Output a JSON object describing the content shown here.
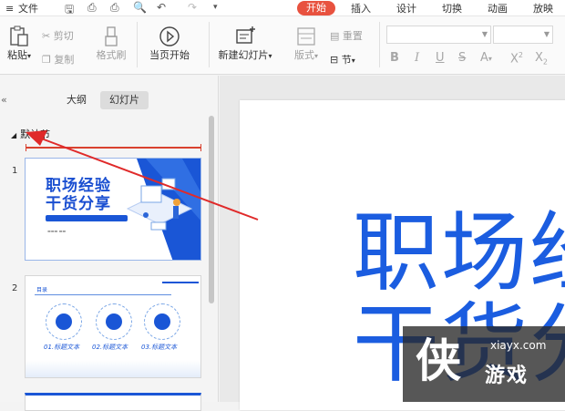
{
  "menubar": {
    "file_label": "文件",
    "tabs": [
      {
        "label": "开始",
        "active": true
      },
      {
        "label": "插入"
      },
      {
        "label": "设计"
      },
      {
        "label": "切换"
      },
      {
        "label": "动画"
      },
      {
        "label": "放映"
      }
    ],
    "accent_color": "#e8523f"
  },
  "ribbon": {
    "paste": "粘贴",
    "cut": "剪切",
    "copy": "复制",
    "format_painter": "格式刷",
    "play_from_current": "当页开始",
    "new_slide": "新建幻灯片",
    "layout": "版式",
    "reset": "重置",
    "section": "节"
  },
  "left_panel": {
    "outline_tab": "大纲",
    "slides_tab": "幻灯片",
    "section_name": "默认节",
    "slides": [
      {
        "number": "1",
        "title_line1": "职场经验",
        "title_line2": "干货分享"
      },
      {
        "number": "2",
        "heading": "目录",
        "items": [
          "01.标题文本",
          "02.标题文本",
          "03.标题文本"
        ]
      }
    ]
  },
  "canvas": {
    "title_line1": "职场经",
    "title_line2": "干货分"
  },
  "watermark": {
    "logo": "侠",
    "site": "xiayx.com",
    "name": "游戏"
  }
}
